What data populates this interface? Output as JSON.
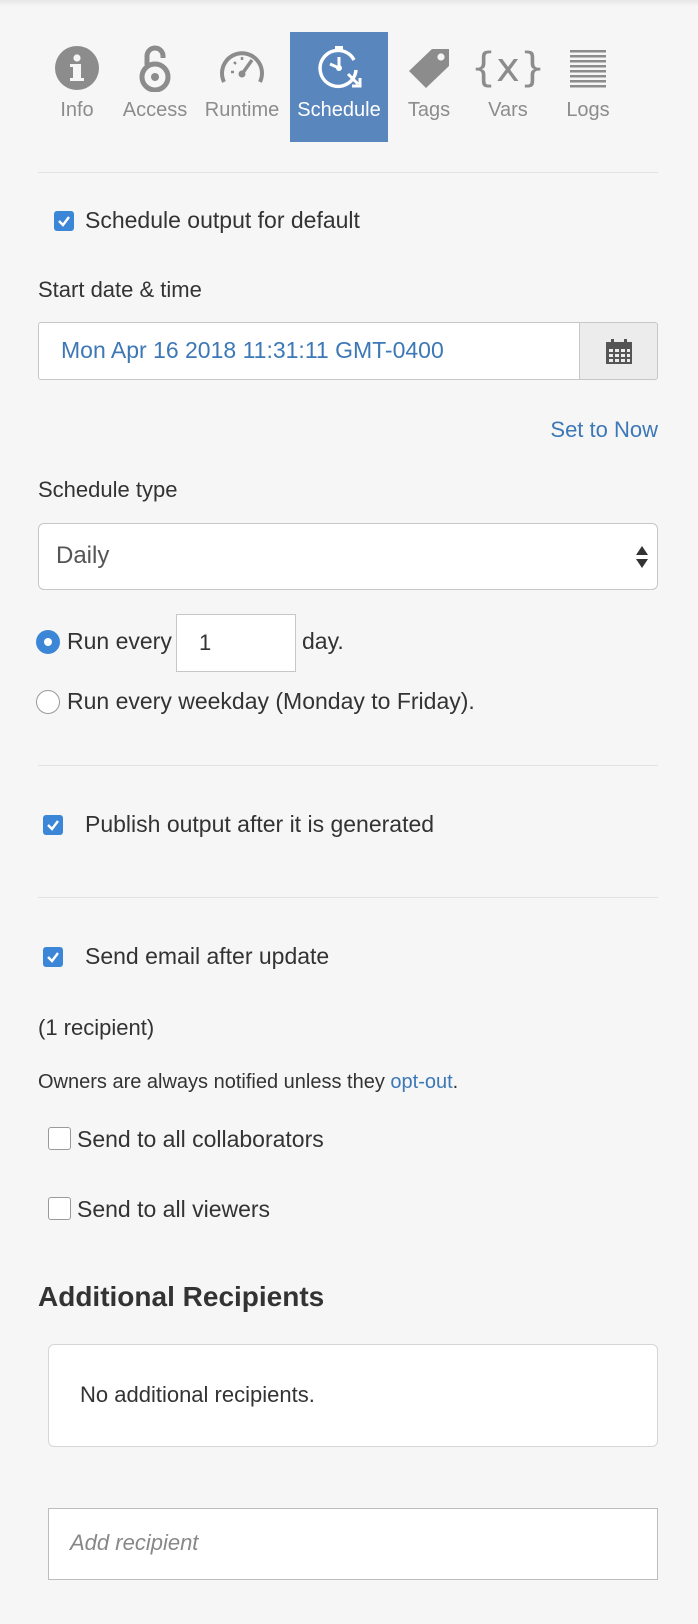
{
  "tabs": [
    {
      "label": "Info",
      "icon": "info-icon"
    },
    {
      "label": "Access",
      "icon": "lock-icon"
    },
    {
      "label": "Runtime",
      "icon": "gauge-icon"
    },
    {
      "label": "Schedule",
      "icon": "clock-icon",
      "active": true
    },
    {
      "label": "Tags",
      "icon": "tag-icon"
    },
    {
      "label": "Vars",
      "icon": "variables-icon"
    },
    {
      "label": "Logs",
      "icon": "logs-icon"
    }
  ],
  "schedule": {
    "enable_label": "Schedule output for default",
    "start_label": "Start date & time",
    "start_value": "Mon Apr 16 2018 11:31:11 GMT-0400",
    "set_now": "Set to Now",
    "type_label": "Schedule type",
    "type_value": "Daily",
    "run_every_prefix": "Run every",
    "run_every_value": "1",
    "run_every_suffix": "day.",
    "weekday_label": "Run every weekday (Monday to Friday)."
  },
  "publish": {
    "label": "Publish output after it is generated"
  },
  "email": {
    "label": "Send email after update",
    "recipient_count": "(1 recipient)",
    "owners_note": "Owners are always notified unless they ",
    "opt_out": "opt-out",
    "period": ".",
    "collaborators_label": "Send to all collaborators",
    "viewers_label": "Send to all viewers"
  },
  "additional": {
    "heading": "Additional Recipients",
    "empty": "No additional recipients.",
    "placeholder": "Add recipient"
  },
  "colors": {
    "accent": "#5986bd",
    "checkbox": "#3c86d8",
    "link": "#3d78b6",
    "background": "#f6f6f6"
  }
}
